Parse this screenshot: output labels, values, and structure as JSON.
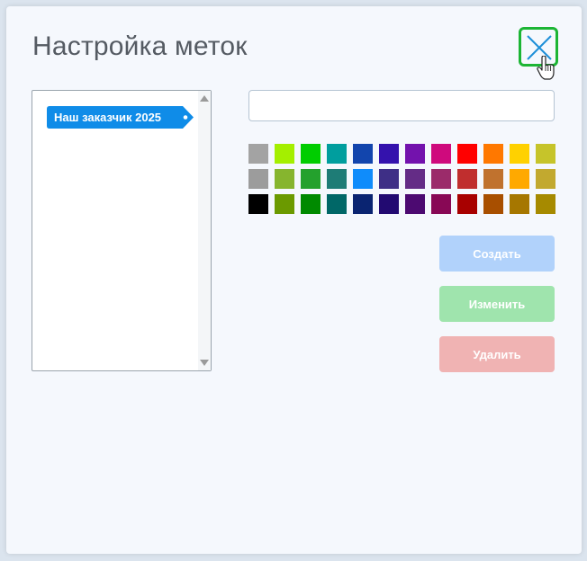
{
  "dialog": {
    "title": "Настройка меток",
    "close_icon": "close-x-icon"
  },
  "tag_list": {
    "items": [
      {
        "label": "Наш заказчик 2025",
        "color": "#0f8ce8"
      }
    ]
  },
  "name_input": {
    "value": "",
    "placeholder": ""
  },
  "palette": {
    "rows": [
      [
        "#a3a3a3",
        "#a4ef00",
        "#00cd00",
        "#009e9e",
        "#1245ad",
        "#3412ad",
        "#7312ad",
        "#cf0a7d",
        "#ff0000",
        "#ff7800",
        "#ffd100",
        "#c6c42a"
      ],
      [
        "#9c9c9c",
        "#86b52e",
        "#24a12d",
        "#1e7c76",
        "#0f8cfb",
        "#3e2f86",
        "#642c86",
        "#9b2b6a",
        "#c02e2e",
        "#c0722e",
        "#ffa900",
        "#c2a92f"
      ],
      [
        "#000000",
        "#6b9a00",
        "#008a00",
        "#006767",
        "#0a2471",
        "#220a71",
        "#4c0a71",
        "#880855",
        "#a80000",
        "#a84f00",
        "#a67700",
        "#a68a00"
      ]
    ]
  },
  "buttons": {
    "create_label": "Создать",
    "edit_label": "Изменить",
    "delete_label": "Удалить"
  }
}
